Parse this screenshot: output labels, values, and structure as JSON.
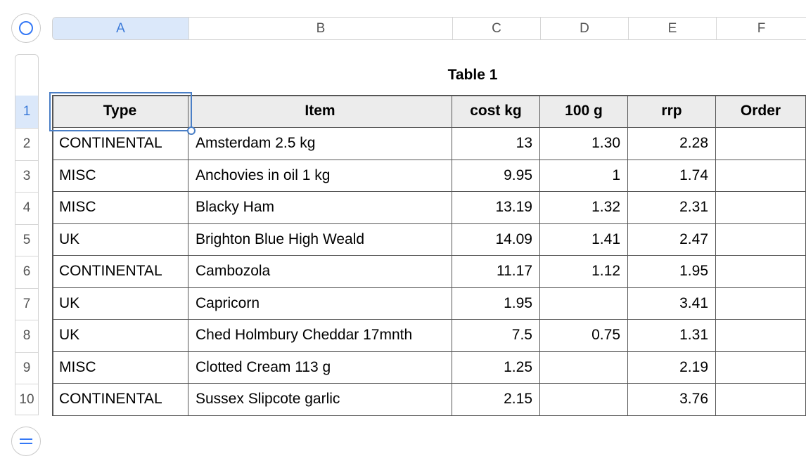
{
  "columns": [
    {
      "letter": "A"
    },
    {
      "letter": "B"
    },
    {
      "letter": "C"
    },
    {
      "letter": "D"
    },
    {
      "letter": "E"
    },
    {
      "letter": "F"
    }
  ],
  "rows": [
    "1",
    "2",
    "3",
    "4",
    "5",
    "6",
    "7",
    "8",
    "9",
    "10"
  ],
  "table": {
    "title": "Table 1",
    "headers": [
      "Type",
      "Item",
      "cost kg",
      "100 g",
      "rrp",
      "Order"
    ],
    "body": [
      [
        "CONTINENTAL",
        "Amsterdam 2.5 kg",
        "13",
        "1.30",
        "2.28",
        ""
      ],
      [
        "MISC",
        "Anchovies in oil 1 kg",
        "9.95",
        "1",
        "1.74",
        ""
      ],
      [
        "MISC",
        "Blacky Ham",
        "13.19",
        "1.32",
        "2.31",
        ""
      ],
      [
        "UK",
        "Brighton Blue High Weald",
        "14.09",
        "1.41",
        "2.47",
        ""
      ],
      [
        "CONTINENTAL",
        "Cambozola",
        "11.17",
        "1.12",
        "1.95",
        ""
      ],
      [
        "UK",
        "Capricorn",
        "1.95",
        "",
        "3.41",
        ""
      ],
      [
        "UK",
        "Ched Holmbury Cheddar 17mnth",
        "7.5",
        "0.75",
        "1.31",
        ""
      ],
      [
        "MISC",
        "Clotted Cream 113 g",
        "1.25",
        "",
        "2.19",
        ""
      ],
      [
        "CONTINENTAL",
        "Sussex Slipcote garlic",
        "2.15",
        "",
        "3.76",
        ""
      ]
    ]
  },
  "selected_cell": "A1",
  "accent_color": "#3478f6"
}
